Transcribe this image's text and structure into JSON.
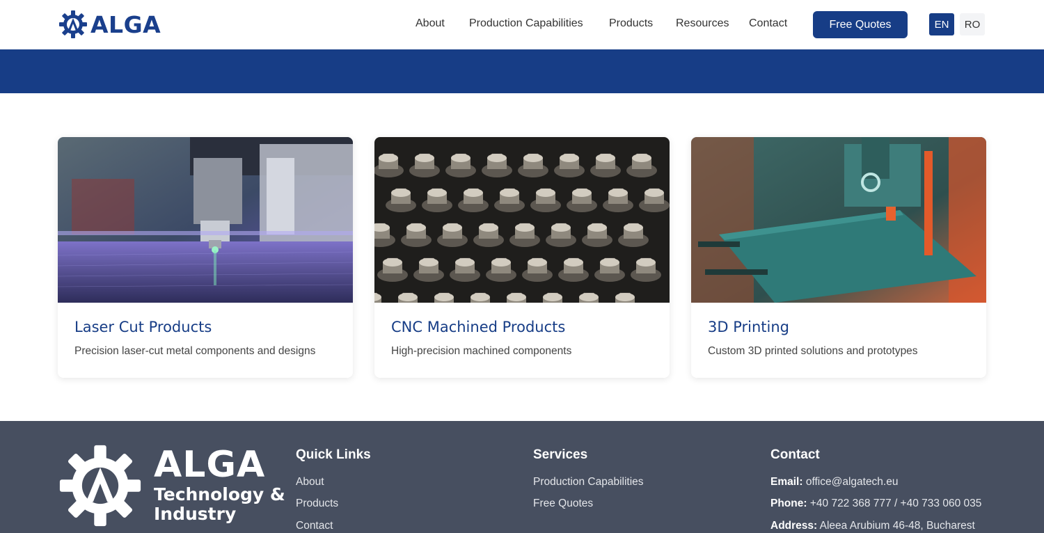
{
  "header": {
    "brand": "ALGA",
    "nav": [
      {
        "label": "About"
      },
      {
        "label": "Production Capabilities"
      },
      {
        "label": "Products"
      },
      {
        "label": "Resources"
      },
      {
        "label": "Contact"
      }
    ],
    "cta_label": "Free Quotes",
    "languages": [
      {
        "code": "EN",
        "active": true
      },
      {
        "code": "RO",
        "active": false
      }
    ]
  },
  "colors": {
    "brand_blue": "#173d86",
    "footer_bg": "#474f60"
  },
  "products": [
    {
      "title": "Laser Cut Products",
      "description": "Precision laser-cut metal components and designs",
      "image": "laser-cutting-machine"
    },
    {
      "title": "CNC Machined Products",
      "description": "High-precision machined components",
      "image": "machined-metal-parts"
    },
    {
      "title": "3D Printing",
      "description": "Custom 3D printed solutions and prototypes",
      "image": "3d-printer"
    }
  ],
  "footer": {
    "brand": "ALGA",
    "brand_line1": "Technology &",
    "brand_line2": "Industry",
    "quick_links": {
      "title": "Quick Links",
      "items": [
        "About",
        "Products",
        "Contact"
      ]
    },
    "services": {
      "title": "Services",
      "items": [
        "Production Capabilities",
        "Free Quotes"
      ]
    },
    "contact": {
      "title": "Contact",
      "email_label": "Email:",
      "email": "office@algatech.eu",
      "phone_label": "Phone:",
      "phone": "+40 722 368 777 / +40 733 060 035",
      "address_label": "Address:",
      "address": "Aleea Arubium 46-48, Bucharest"
    }
  }
}
